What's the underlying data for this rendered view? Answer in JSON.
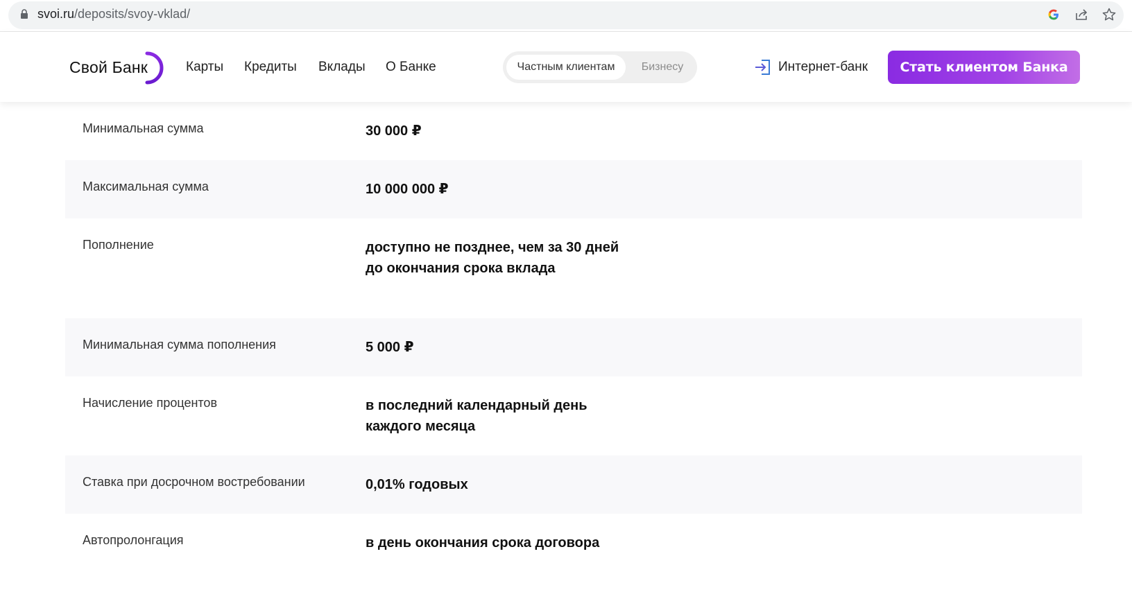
{
  "browser": {
    "url_host": "svoi.ru",
    "url_path": "/deposits/svoy-vklad/"
  },
  "header": {
    "logo_text": "Свой Банк",
    "nav": [
      "Карты",
      "Кредиты",
      "Вклады",
      "О Банке"
    ],
    "segment": {
      "active": "Частным клиентам",
      "inactive": "Бизнесу"
    },
    "internet_bank": "Интернет-банк",
    "cta": "Стать клиентом Банка"
  },
  "params": [
    {
      "label": "Минимальная сумма",
      "value": "30 000 ₽"
    },
    {
      "label": "Максимальная сумма",
      "value": "10 000 000 ₽"
    },
    {
      "label": "Пополнение",
      "value": "доступно не позднее, чем за 30 дней до окончания срока вклада"
    },
    {
      "label": "Минимальная сумма пополнения",
      "value": "5 000 ₽"
    },
    {
      "label": "Начисление процентов",
      "value": "в последний календарный день каждого месяца"
    },
    {
      "label": "Ставка при досрочном востребовании",
      "value": "0,01% годовых"
    },
    {
      "label": "Автопролонгация",
      "value": "в день окончания срока договора"
    }
  ],
  "colors": {
    "accent": "#8a2be2",
    "accent_light": "#c26ee6",
    "row_shade": "#f8f8fa"
  }
}
